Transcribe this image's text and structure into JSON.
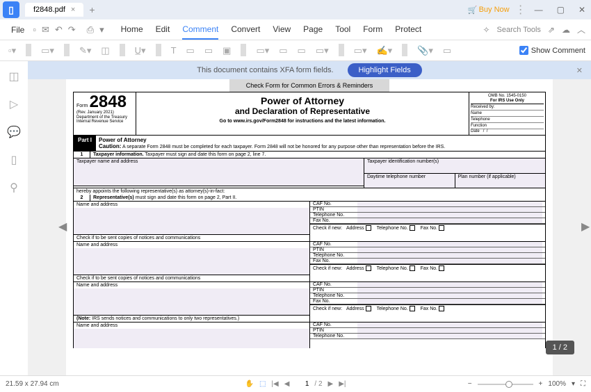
{
  "titlebar": {
    "tab_name": "f2848.pdf",
    "buy_now": "Buy Now"
  },
  "menu": {
    "file": "File",
    "tabs": [
      "Home",
      "Edit",
      "Comment",
      "Convert",
      "View",
      "Page",
      "Tool",
      "Form",
      "Protect"
    ],
    "active_tab": 2,
    "search_placeholder": "Search Tools"
  },
  "toolbar": {
    "show_comment": "Show Comment"
  },
  "xfa_banner": {
    "text": "This document contains XFA form fields.",
    "button": "Highlight Fields"
  },
  "form": {
    "check_banner": "Check Form for Common Errors & Reminders",
    "form_label": "Form",
    "form_number": "2848",
    "rev": "(Rev. January 2021)",
    "dept": "Department of the Treasury",
    "irs": "Internal Revenue Service",
    "title": "Power of Attorney",
    "subtitle": "and Declaration of Representative",
    "url": "Go to www.irs.gov/Form2848 for instructions and the latest information.",
    "omb": "OMB No. 1545-0150",
    "irs_only": "For IRS Use Only",
    "received_by": "Received by:",
    "name_lbl": "Name",
    "telephone_lbl": "Telephone",
    "function_lbl": "Function",
    "date_lbl": "Date",
    "part1": "Part I",
    "part1_title": "Power of Attorney",
    "caution": "Caution: A separate Form 2848 must be completed for each taxpayer. Form 2848 will not be honored for any purpose other than representation before the IRS.",
    "row1_num": "1",
    "row1_text": "Taxpayer information. Taxpayer must sign and date this form on page 2, line 7.",
    "tp_name": "Taxpayer name and address",
    "tp_id": "Taxpayer identification number(s)",
    "daytime_tel": "Daytime telephone number",
    "plan_num": "Plan number (if applicable)",
    "appoints": "hereby appoints the following representative(s) as attorney(s)-in-fact:",
    "row2_num": "2",
    "row2_text": "Representative(s) must sign and date this form on page 2, Part II.",
    "name_addr": "Name and address",
    "caf": "CAF No.",
    "ptin": "PTIN",
    "tel_no": "Telephone No.",
    "fax_no": "Fax No.",
    "check_new": "Check if new:",
    "address": "Address",
    "check_copies": "Check if to be sent copies of notices and communications",
    "note": "(Note: IRS sends notices and communications to only two representatives.)"
  },
  "statusbar": {
    "dims": "21.59 x 27.94 cm",
    "page_current": "1",
    "page_total": "/ 2",
    "zoom": "100%"
  },
  "page_badge": "1 / 2"
}
